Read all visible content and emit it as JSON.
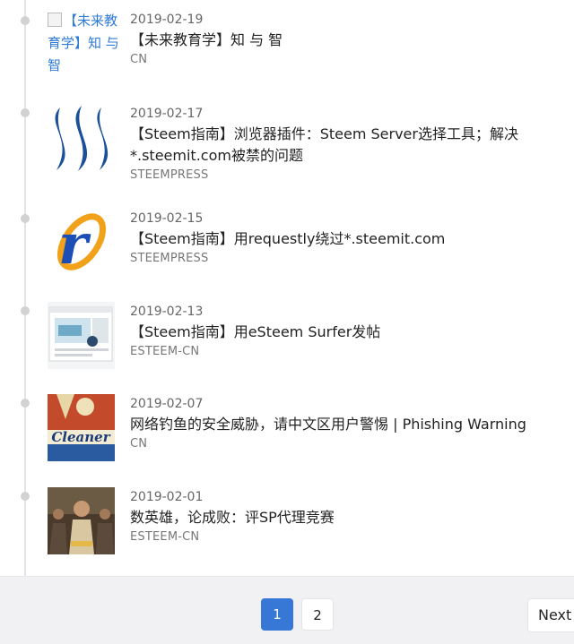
{
  "posts": [
    {
      "date": "2019-02-19",
      "title": "【未来教育学】知 与 智",
      "tag": "CN",
      "thumb_alt": "【未来教育学】知 与 智",
      "thumb_type": "broken-image"
    },
    {
      "date": "2019-02-17",
      "title": "【Steem指南】浏览器插件：Steem Server选择工具；解决*.steemit.com被禁的问题",
      "tag": "STEEMPRESS",
      "thumb_type": "steem-logo"
    },
    {
      "date": "2019-02-15",
      "title": "【Steem指南】用requestly绕过*.steemit.com",
      "tag": "STEEMPRESS",
      "thumb_type": "requestly-logo"
    },
    {
      "date": "2019-02-13",
      "title": "【Steem指南】用eSteem Surfer发帖",
      "tag": "ESTEEM-CN",
      "thumb_type": "app-screenshot"
    },
    {
      "date": "2019-02-07",
      "title": "网络钓鱼的安全威胁，请中文区用户警惕 | Phishing Warning",
      "tag": "CN",
      "thumb_type": "cleaner-image",
      "thumb_text": "Cleaner"
    },
    {
      "date": "2019-02-01",
      "title": "数英雄，论成败：评SP代理竞赛",
      "tag": "ESTEEM-CN",
      "thumb_type": "photo"
    }
  ],
  "pagination": {
    "pages": [
      "1",
      "2"
    ],
    "current": "1",
    "next_label": "Next"
  },
  "colors": {
    "accent": "#3778d6",
    "timeline": "#e4e4e4",
    "dot": "#d2d2d2",
    "pager_bg": "#f1f1f3"
  }
}
